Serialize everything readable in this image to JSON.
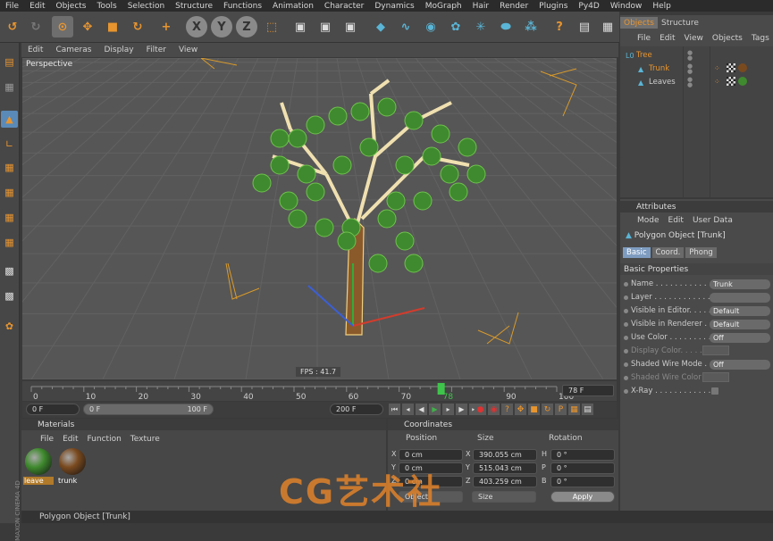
{
  "menubar": [
    "File",
    "Edit",
    "Objects",
    "Tools",
    "Selection",
    "Structure",
    "Functions",
    "Animation",
    "Character",
    "Dynamics",
    "MoGraph",
    "Hair",
    "Render",
    "Plugins",
    "Py4D",
    "Window",
    "Help"
  ],
  "viewport": {
    "menu": [
      "Edit",
      "Cameras",
      "Display",
      "Filter",
      "View"
    ],
    "name": "Perspective",
    "fps": "FPS : 41.7"
  },
  "timeline": {
    "ticks": [
      "0",
      "10",
      "20",
      "30",
      "40",
      "50",
      "60",
      "70",
      "78",
      "90",
      "100"
    ],
    "current_frame": "78 F",
    "start_field": "0 F",
    "range_start": "0 F",
    "range_end": "100 F",
    "end_field": "200 F",
    "playhead_fraction": 0.78
  },
  "materials": {
    "title": "Materials",
    "menu": [
      "File",
      "Edit",
      "Function",
      "Texture"
    ],
    "items": [
      {
        "name": "leave",
        "color": "#3f8a2e"
      },
      {
        "name": "trunk",
        "color": "#7a4a1f"
      }
    ]
  },
  "coordinates": {
    "title": "Coordinates",
    "headers": [
      "Position",
      "Size",
      "Rotation"
    ],
    "rows": [
      {
        "axis": "X",
        "pos": "0 cm",
        "size_axis": "X",
        "size": "390.055 cm",
        "rot_axis": "H",
        "rot": "0 °"
      },
      {
        "axis": "Y",
        "pos": "0 cm",
        "size_axis": "Y",
        "size": "515.043 cm",
        "rot_axis": "P",
        "rot": "0 °"
      },
      {
        "axis": "Z",
        "pos": "0 cm",
        "size_axis": "Z",
        "size": "403.259 cm",
        "rot_axis": "B",
        "rot": "0 °"
      }
    ],
    "mode": "Object",
    "size_mode": "Size",
    "apply": "Apply"
  },
  "objects": {
    "tabs": [
      "Objects",
      "Structure"
    ],
    "menu": [
      "File",
      "Edit",
      "View",
      "Objects",
      "Tags"
    ],
    "tree": [
      {
        "name": "Tree",
        "indent": 0,
        "color": "#e8952f"
      },
      {
        "name": "Trunk",
        "indent": 1,
        "color": "#e8952f"
      },
      {
        "name": "Leaves",
        "indent": 1,
        "color": "#cfcfcf"
      }
    ]
  },
  "attributes": {
    "title": "Attributes",
    "menu": [
      "Mode",
      "Edit",
      "User Data"
    ],
    "object_title": "Polygon Object [Trunk]",
    "tabs": [
      "Basic",
      "Coord.",
      "Phong"
    ],
    "section": "Basic Properties",
    "rows": [
      {
        "label": "Name . . . . . . . . . . . . .",
        "value": "Trunk",
        "dim": false
      },
      {
        "label": "Layer . . . . . . . . . . . . .",
        "value": "",
        "dim": false
      },
      {
        "label": "Visible in Editor. . . . .",
        "value": "Default",
        "dim": false
      },
      {
        "label": "Visible in Renderer . . .",
        "value": "Default",
        "dim": false
      },
      {
        "label": "Use Color . . . . . . . . .",
        "value": "Off",
        "dim": false
      },
      {
        "label": "Display Color. . . . . .",
        "value": "",
        "dim": true
      },
      {
        "label": "Shaded Wire Mode . .",
        "value": "Off",
        "dim": false
      },
      {
        "label": "Shaded Wire Color . .",
        "value": "",
        "dim": true
      },
      {
        "label": "X-Ray . . . . . . . . . . . .",
        "value": "",
        "dim": false
      }
    ]
  },
  "status": "Polygon Object [Trunk]",
  "side_logo": "MAXON CINEMA 4D",
  "watermark": "CG艺术社",
  "colors": {
    "accent": "#e8952f",
    "selected_tab": "#7e9cc0",
    "axis_x": "#d23c2c",
    "axis_y": "#2fae3a",
    "axis_z": "#3b5fd6"
  }
}
